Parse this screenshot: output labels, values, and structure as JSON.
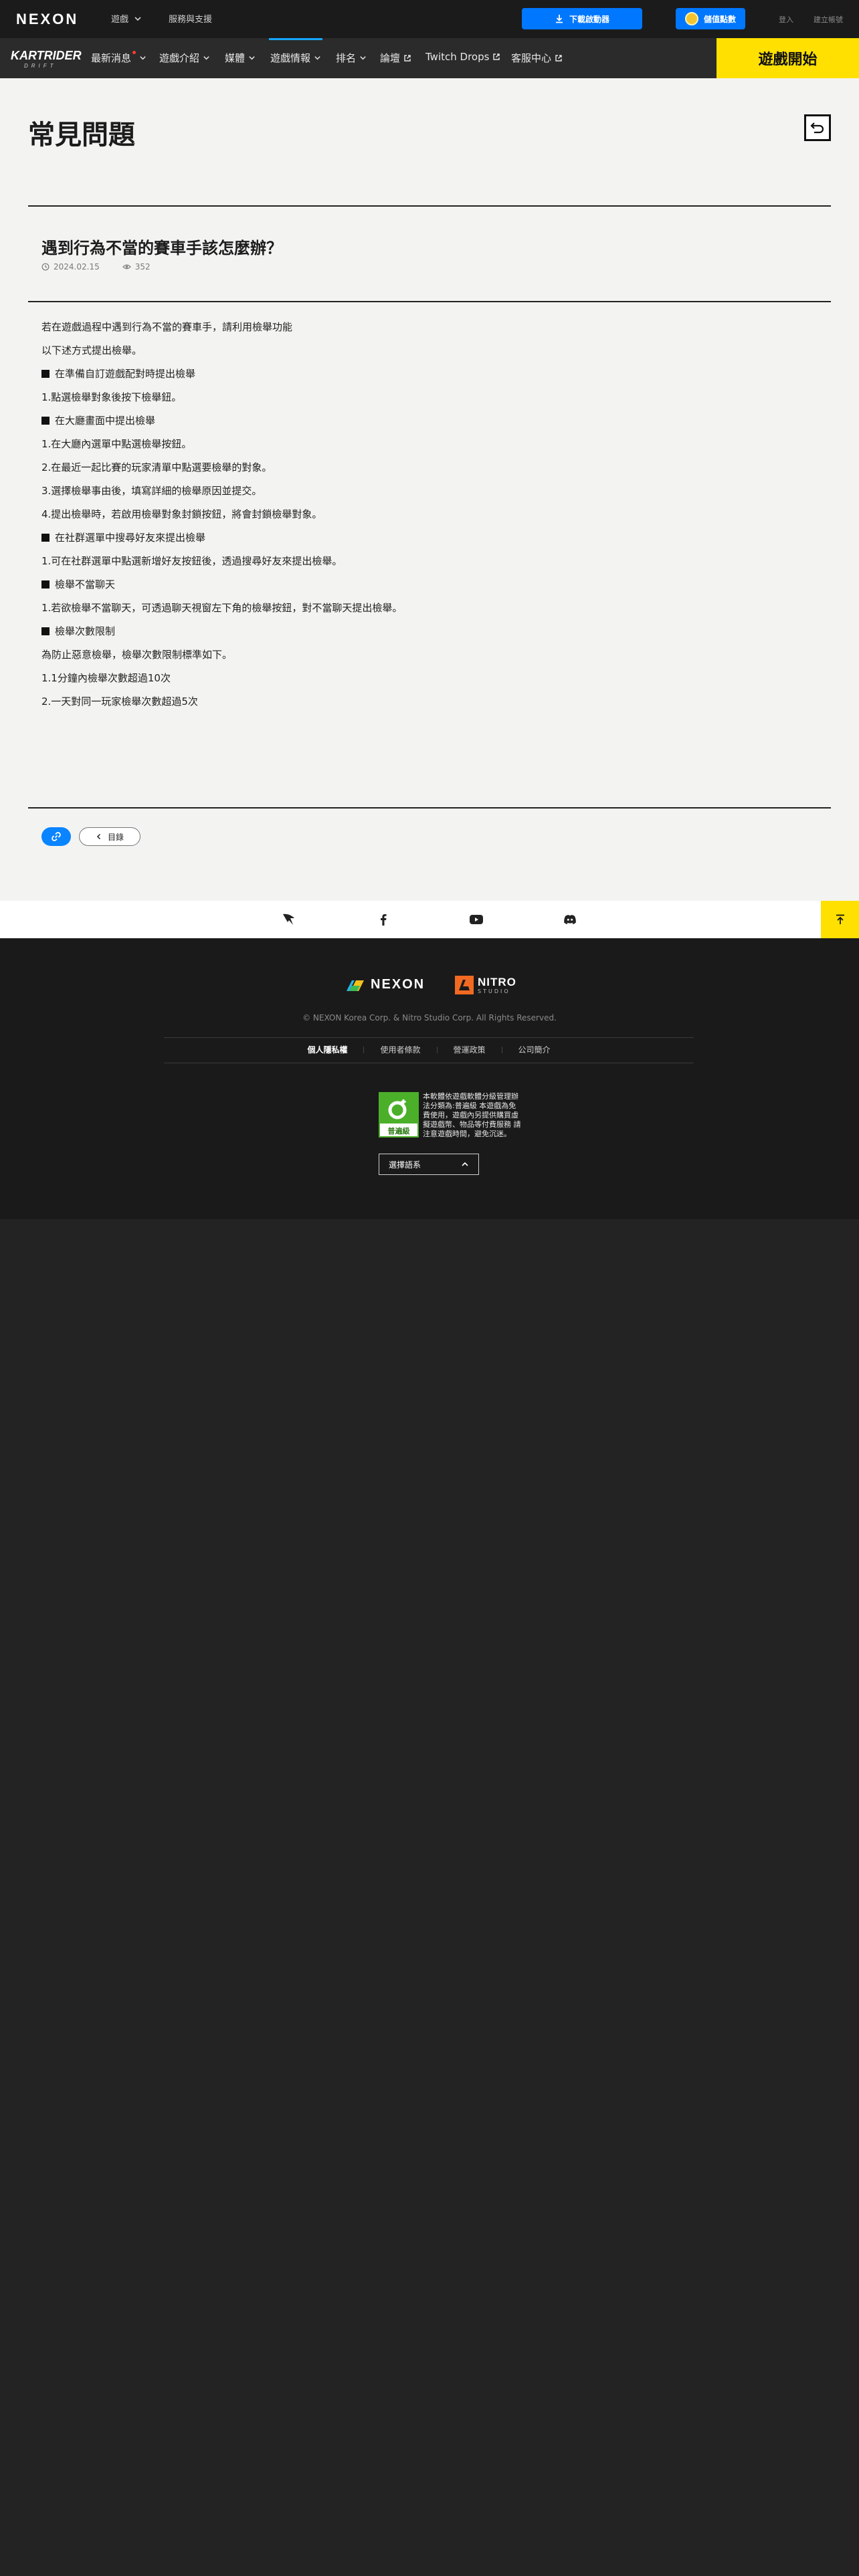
{
  "topbar": {
    "logo": "NEXON",
    "games_label": "遊戲",
    "support_label": "服務與支援",
    "download_label": "下載啟動器",
    "points_label": "儲值點數",
    "login_label": "登入",
    "register_label": "建立帳號"
  },
  "gamebar": {
    "logo_text": "KARTRIDER",
    "logo_sub": "DRIFT",
    "items": [
      {
        "label": "最新消息"
      },
      {
        "label": "遊戲介紹"
      },
      {
        "label": "媒體"
      },
      {
        "label": "遊戲情報"
      },
      {
        "label": "排名"
      },
      {
        "label": "論壇"
      },
      {
        "label": "Twitch Drops"
      },
      {
        "label": "客服中心"
      }
    ],
    "start_label": "遊戲開始"
  },
  "page": {
    "title": "常見問題",
    "question_title": "遇到行為不當的賽車手該怎麼辦？",
    "date": "2024.02.15",
    "views": "352",
    "body": [
      {
        "type": "text",
        "text": "若在遊戲過程中遇到行為不當的賽車手，請利用檢舉功能"
      },
      {
        "type": "text",
        "text": "以下述方式提出檢舉。"
      },
      {
        "type": "blank",
        "text": ""
      },
      {
        "type": "head",
        "text": "在準備自訂遊戲配對時提出檢舉"
      },
      {
        "type": "text",
        "text": "1.點選檢舉對象後按下檢舉鈕。"
      },
      {
        "type": "blank",
        "text": ""
      },
      {
        "type": "head",
        "text": "在大廳畫面中提出檢舉"
      },
      {
        "type": "text",
        "text": "1.在大廳內選單中點選檢舉按鈕。"
      },
      {
        "type": "text",
        "text": "2.在最近一起比賽的玩家清單中點選要檢舉的對象。"
      },
      {
        "type": "text",
        "text": "3.選擇檢舉事由後，填寫詳細的檢舉原因並提交。"
      },
      {
        "type": "text",
        "text": "4.提出檢舉時，若啟用檢舉對象封鎖按鈕，將會封鎖檢舉對象。"
      },
      {
        "type": "blank",
        "text": ""
      },
      {
        "type": "head",
        "text": "在社群選單中搜尋好友來提出檢舉"
      },
      {
        "type": "text",
        "text": "1.可在社群選單中點選新增好友按鈕後，透過搜尋好友來提出檢舉。"
      },
      {
        "type": "blank",
        "text": ""
      },
      {
        "type": "head",
        "text": "檢舉不當聊天"
      },
      {
        "type": "text",
        "text": "1.若欲檢舉不當聊天，可透過聊天視窗左下角的檢舉按鈕，對不當聊天提出檢舉。"
      },
      {
        "type": "blank",
        "text": ""
      },
      {
        "type": "head",
        "text": "檢舉次數限制"
      },
      {
        "type": "text",
        "text": "為防止惡意檢舉，檢舉次數限制標準如下。"
      },
      {
        "type": "text",
        "text": "1.1分鐘內檢舉次數超過10次"
      },
      {
        "type": "text",
        "text": "2.一天對同一玩家檢舉次數超過5次"
      }
    ],
    "list_label": "目錄"
  },
  "footer": {
    "nexon_logo": "NEXON",
    "nitro_logo": "NITRO",
    "nitro_sub": "STUDIO",
    "copyright": "© NEXON Korea Corp. & Nitro Studio Corp. All Rights Reserved.",
    "links": [
      {
        "label": "個人隱私權"
      },
      {
        "label": "使用者條款"
      },
      {
        "label": "營運政策"
      },
      {
        "label": "公司簡介"
      }
    ],
    "rating_label": "普遍級",
    "rating_text": "本軟體依遊戲軟體分級管理辦法分類為:普遍級 本遊戲為免費使用，遊戲內另提供購買虛擬遊戲幣、物品等付費服務 請注意遊戲時間，避免沉迷。",
    "language_label": "選擇語系"
  },
  "colors": {
    "accent_yellow": "#ffe000",
    "accent_blue": "#0077ff",
    "active_tab": "#16a6ff"
  }
}
